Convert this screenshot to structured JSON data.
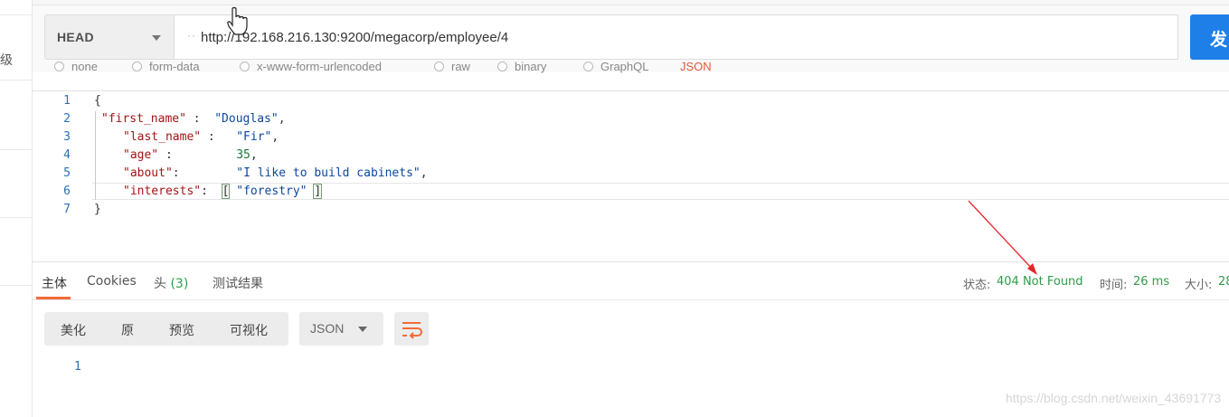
{
  "sidebar": {
    "level_label": "级"
  },
  "request": {
    "method": "HEAD",
    "url_prefix_dots": "··",
    "url": "http://192.168.216.130:9200/megacorp/employee/4",
    "send_label": "发",
    "body_types": [
      {
        "label": "none"
      },
      {
        "label": "form-data"
      },
      {
        "label": "x-www-form-urlencoded"
      },
      {
        "label": "raw"
      },
      {
        "label": "binary"
      },
      {
        "label": "GraphQL"
      },
      {
        "label": "JSON"
      }
    ]
  },
  "editor": {
    "line_numbers": [
      "1",
      "2",
      "3",
      "4",
      "5",
      "6",
      "7"
    ],
    "lines": {
      "l1": "{",
      "l2_key": "\"first_name\"",
      "l2_sep": " :  ",
      "l2_val": "\"Douglas\"",
      "l2_end": ",",
      "l3_key": "\"last_name\"",
      "l3_sep": " :   ",
      "l3_val": "\"Fir\"",
      "l3_end": ",",
      "l4_key": "\"age\"",
      "l4_sep": " :         ",
      "l4_val": "35",
      "l4_end": ",",
      "l5_key": "\"about\"",
      "l5_sep": ":        ",
      "l5_val": "\"I like to build cabinets\"",
      "l5_end": ",",
      "l6_key": "\"interests\"",
      "l6_sep": ":  ",
      "l6_open": "[",
      "l6_val": " \"forestry\" ",
      "l6_close": "]",
      "l7": "}"
    }
  },
  "response": {
    "tabs": [
      {
        "label": "主体"
      },
      {
        "label": "Cookies"
      },
      {
        "label": "头",
        "count": "(3)"
      },
      {
        "label": "测试结果"
      }
    ],
    "status_label": "状态:",
    "status_value": "404 Not Found",
    "time_label": "时间:",
    "time_value": "26 ms",
    "size_label": "大小:",
    "size_value": "28",
    "view_buttons": [
      "美化",
      "原",
      "预览",
      "可视化"
    ],
    "format": "JSON",
    "wrap_icon": "wrap-lines-icon",
    "body_line_number": "1"
  },
  "watermark": "https://blog.csdn.net/weixin_43691773",
  "colors": {
    "accent_orange": "#f26b3a",
    "send_blue": "#1f7fe8",
    "status_green": "#2e9b48",
    "annotation_red": "#e8262a"
  }
}
